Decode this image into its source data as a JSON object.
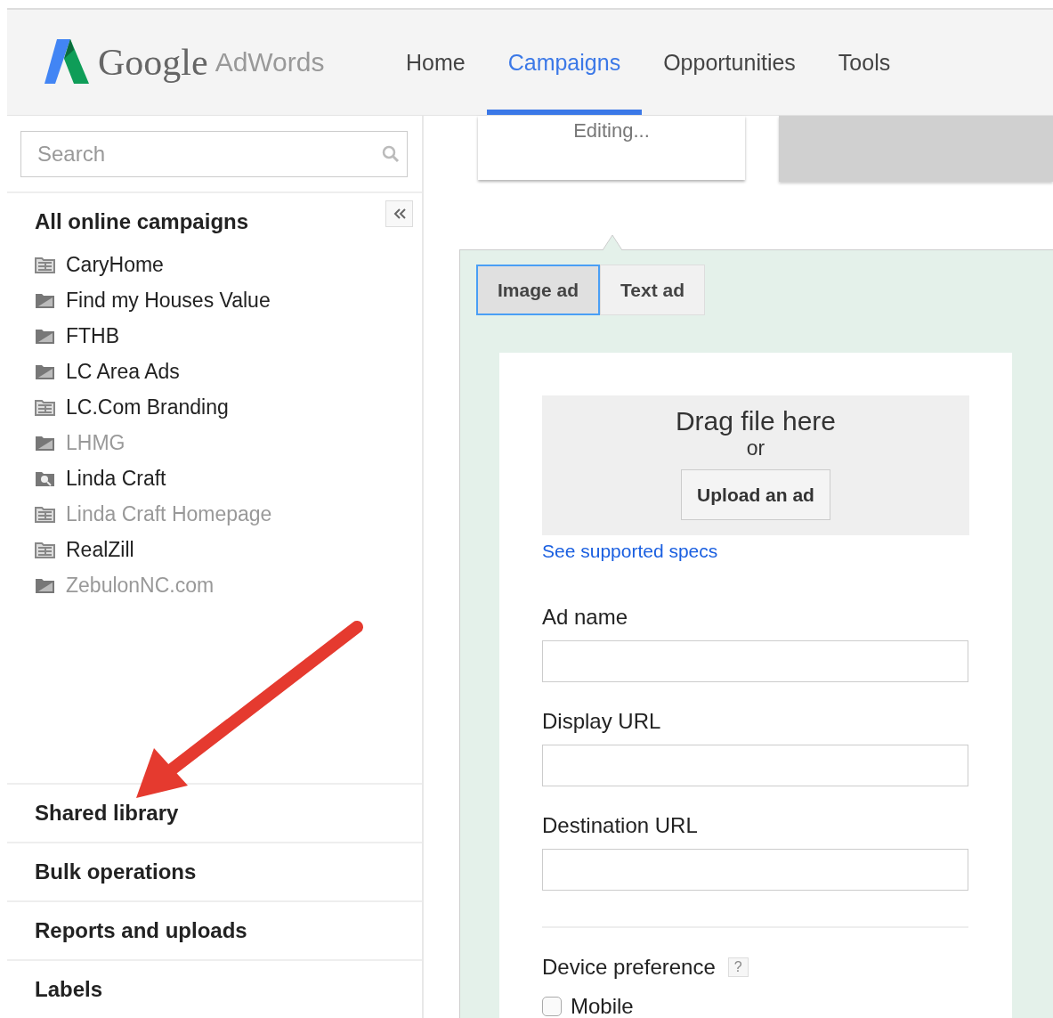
{
  "header": {
    "logo_google": "Google",
    "logo_product": "AdWords",
    "nav": [
      {
        "label": "Home",
        "selected": false
      },
      {
        "label": "Campaigns",
        "selected": true
      },
      {
        "label": "Opportunities",
        "selected": false
      },
      {
        "label": "Tools",
        "selected": false
      }
    ]
  },
  "sidebar": {
    "search": {
      "placeholder": "Search"
    },
    "title": "All online campaigns",
    "campaigns": [
      {
        "label": "CaryHome",
        "kind": "display",
        "disabled": false
      },
      {
        "label": "Find my Houses Value",
        "kind": "folder",
        "disabled": false
      },
      {
        "label": "FTHB",
        "kind": "folder",
        "disabled": false
      },
      {
        "label": "LC Area Ads",
        "kind": "folder",
        "disabled": false
      },
      {
        "label": "LC.Com Branding",
        "kind": "display",
        "disabled": false
      },
      {
        "label": "LHMG",
        "kind": "folder",
        "disabled": true
      },
      {
        "label": "Linda Craft",
        "kind": "search",
        "disabled": false
      },
      {
        "label": "Linda Craft Homepage",
        "kind": "display",
        "disabled": true
      },
      {
        "label": "RealZill",
        "kind": "display",
        "disabled": false
      },
      {
        "label": "ZebulonNC.com",
        "kind": "folder",
        "disabled": true
      }
    ],
    "sections": [
      "Shared library",
      "Bulk operations",
      "Reports and uploads",
      "Labels"
    ]
  },
  "main": {
    "editing_card": "Editing...",
    "ad_tabs": [
      {
        "label": "Image ad",
        "selected": true
      },
      {
        "label": "Text ad",
        "selected": false
      }
    ],
    "drop_zone": {
      "title": "Drag file here",
      "or": "or",
      "button": "Upload an ad"
    },
    "specs_link": "See supported specs",
    "fields": [
      {
        "label": "Ad name"
      },
      {
        "label": "Display URL"
      },
      {
        "label": "Destination URL"
      }
    ],
    "device": {
      "label": "Device preference",
      "help": "?",
      "options": [
        {
          "label": "Mobile",
          "checked": false
        }
      ]
    }
  }
}
